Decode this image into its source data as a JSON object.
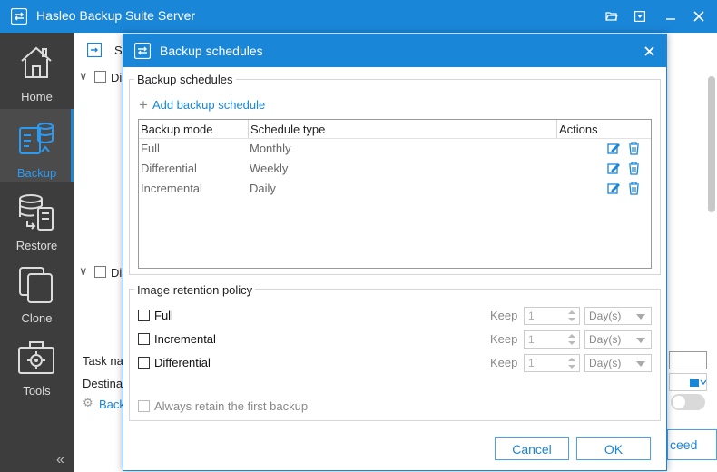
{
  "app": {
    "title": "Hasleo Backup Suite Server"
  },
  "colors": {
    "accent": "#1a86d8",
    "sidebar": "#3d3d3d",
    "sidebar_active": "#4b4b4b"
  },
  "sidebar": {
    "items": [
      {
        "label": "Home",
        "icon": "home-icon"
      },
      {
        "label": "Backup",
        "icon": "backup-icon",
        "active": true
      },
      {
        "label": "Restore",
        "icon": "restore-icon"
      },
      {
        "label": "Clone",
        "icon": "clone-icon"
      },
      {
        "label": "Tools",
        "icon": "tools-icon"
      }
    ]
  },
  "background": {
    "header_fragment": "S",
    "section1_fragment": "Di",
    "section2_fragment": "Di",
    "task_name_fragment": "Task na",
    "destination_fragment": "Destinat",
    "backup_link_fragment": "Back",
    "proceed_fragment": "ceed"
  },
  "dialog": {
    "title": "Backup schedules",
    "schedules_group": "Backup schedules",
    "add_label": "Add backup schedule",
    "columns": [
      "Backup mode",
      "Schedule type",
      "Actions"
    ],
    "rows": [
      {
        "mode": "Full",
        "schedule": "Monthly"
      },
      {
        "mode": "Differential",
        "schedule": "Weekly"
      },
      {
        "mode": "Incremental",
        "schedule": "Daily"
      }
    ],
    "retention_group": "Image retention policy",
    "retention": [
      {
        "label": "Full",
        "keep": "Keep",
        "value": "1",
        "unit": "Day(s)"
      },
      {
        "label": "Incremental",
        "keep": "Keep",
        "value": "1",
        "unit": "Day(s)"
      },
      {
        "label": "Differential",
        "keep": "Keep",
        "value": "1",
        "unit": "Day(s)"
      }
    ],
    "retain_first": "Always retain the first backup",
    "cancel": "Cancel",
    "ok": "OK"
  }
}
